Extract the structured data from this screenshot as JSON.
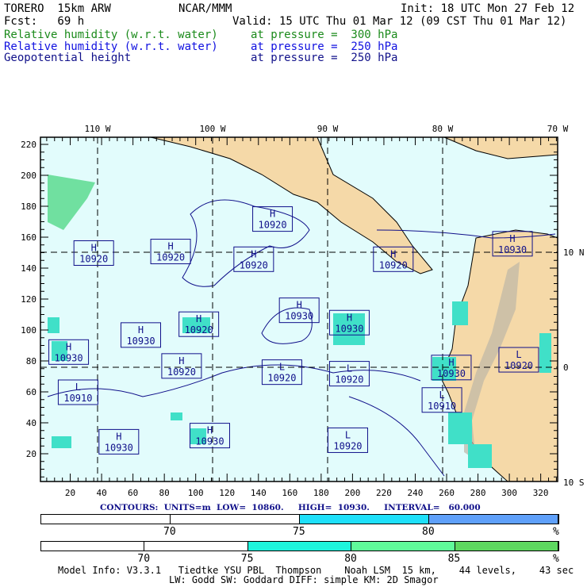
{
  "header": {
    "model": "TORERO  15km ARW",
    "org": "NCAR/MMM",
    "init": "Init: 18 UTC Mon 27 Feb 12",
    "fcst": "Fcst:   69 h",
    "valid": "Valid: 15 UTC Thu 01 Mar 12 (09 CST Thu 01 Mar 12)",
    "fields": [
      {
        "name": "Relative humidity (w.r.t. water)",
        "level": "at pressure =  300 hPa",
        "color": "#1a8a1a"
      },
      {
        "name": "Relative humidity (w.r.t. water)",
        "level": "at pressure =  250 hPa",
        "color": "#1010e0"
      },
      {
        "name": "Geopotential height",
        "level": "at pressure =  250 hPa",
        "color": "#10108a"
      }
    ]
  },
  "axes": {
    "x_ticks": [
      "20",
      "40",
      "60",
      "80",
      "100",
      "120",
      "140",
      "160",
      "180",
      "200",
      "220",
      "240",
      "260",
      "280",
      "300",
      "320"
    ],
    "y_ticks": [
      "20",
      "40",
      "60",
      "80",
      "100",
      "120",
      "140",
      "160",
      "180",
      "200",
      "220"
    ],
    "lon_labels": [
      "110 W",
      "100 W",
      "90 W",
      "80 W",
      "70 W"
    ],
    "lat_labels": [
      "10 N",
      "0",
      "10 S"
    ]
  },
  "centers": [
    {
      "type": "H",
      "value": "10920",
      "gx": 149,
      "gy": 172
    },
    {
      "type": "H",
      "value": "10920",
      "gx": 35,
      "gy": 150
    },
    {
      "type": "H",
      "value": "10920",
      "gx": 84,
      "gy": 151
    },
    {
      "type": "H",
      "value": "10920",
      "gx": 137,
      "gy": 146
    },
    {
      "type": "H",
      "value": "10920",
      "gx": 226,
      "gy": 146
    },
    {
      "type": "H",
      "value": "10930",
      "gx": 302,
      "gy": 156
    },
    {
      "type": "H",
      "value": "10930",
      "gx": 166,
      "gy": 113
    },
    {
      "type": "H",
      "value": "10920",
      "gx": 102,
      "gy": 104
    },
    {
      "type": "H",
      "value": "10930",
      "gx": 65,
      "gy": 97
    },
    {
      "type": "H",
      "value": "10930",
      "gx": 198,
      "gy": 105
    },
    {
      "type": "H",
      "value": "10930",
      "gx": 19,
      "gy": 86
    },
    {
      "type": "H",
      "value": "10920",
      "gx": 91,
      "gy": 77
    },
    {
      "type": "L",
      "value": "10920",
      "gx": 155,
      "gy": 73
    },
    {
      "type": "L",
      "value": "10920",
      "gx": 198,
      "gy": 72
    },
    {
      "type": "H",
      "value": "10930",
      "gx": 263,
      "gy": 76
    },
    {
      "type": "L",
      "value": "10920",
      "gx": 306,
      "gy": 81
    },
    {
      "type": "L",
      "value": "10910",
      "gx": 25,
      "gy": 60
    },
    {
      "type": "L",
      "value": "10910",
      "gx": 257,
      "gy": 55
    },
    {
      "type": "H",
      "value": "10930",
      "gx": 109,
      "gy": 32
    },
    {
      "type": "H",
      "value": "10930",
      "gx": 51,
      "gy": 28
    },
    {
      "type": "L",
      "value": "10920",
      "gx": 197,
      "gy": 29
    }
  ],
  "contour_info": "CONTOURS:  UNITS=m  LOW=  10860.     HIGH=  10930.     INTERVAL=   60.000",
  "colorbar1": {
    "labels": [
      "70",
      "75",
      "80",
      "%"
    ],
    "colors": [
      "#ffffff",
      "#ffffff",
      "#1ee0fa",
      "#5fa0fa"
    ]
  },
  "colorbar2": {
    "labels": [
      "70",
      "75",
      "80",
      "85",
      "%"
    ],
    "colors": [
      "#ffffff",
      "#ffffff",
      "#1ef5dc",
      "#60fa9a",
      "#5ed860"
    ]
  },
  "footer": {
    "line1": "Model Info: V3.3.1   Tiedtke YSU PBL  Thompson    Noah LSM  15 km,    44 levels,    43 sec",
    "line2": "LW: Godd SW: Goddard DIFF: simple KM: 2D Smagor"
  }
}
